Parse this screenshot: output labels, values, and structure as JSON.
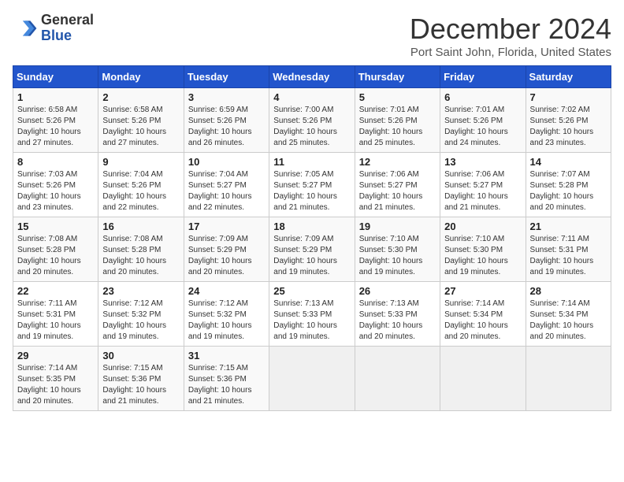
{
  "header": {
    "logo_line1": "General",
    "logo_line2": "Blue",
    "title": "December 2024",
    "subtitle": "Port Saint John, Florida, United States"
  },
  "days_of_week": [
    "Sunday",
    "Monday",
    "Tuesday",
    "Wednesday",
    "Thursday",
    "Friday",
    "Saturday"
  ],
  "weeks": [
    [
      {
        "day": "1",
        "info": "Sunrise: 6:58 AM\nSunset: 5:26 PM\nDaylight: 10 hours\nand 27 minutes."
      },
      {
        "day": "2",
        "info": "Sunrise: 6:58 AM\nSunset: 5:26 PM\nDaylight: 10 hours\nand 27 minutes."
      },
      {
        "day": "3",
        "info": "Sunrise: 6:59 AM\nSunset: 5:26 PM\nDaylight: 10 hours\nand 26 minutes."
      },
      {
        "day": "4",
        "info": "Sunrise: 7:00 AM\nSunset: 5:26 PM\nDaylight: 10 hours\nand 25 minutes."
      },
      {
        "day": "5",
        "info": "Sunrise: 7:01 AM\nSunset: 5:26 PM\nDaylight: 10 hours\nand 25 minutes."
      },
      {
        "day": "6",
        "info": "Sunrise: 7:01 AM\nSunset: 5:26 PM\nDaylight: 10 hours\nand 24 minutes."
      },
      {
        "day": "7",
        "info": "Sunrise: 7:02 AM\nSunset: 5:26 PM\nDaylight: 10 hours\nand 23 minutes."
      }
    ],
    [
      {
        "day": "8",
        "info": "Sunrise: 7:03 AM\nSunset: 5:26 PM\nDaylight: 10 hours\nand 23 minutes."
      },
      {
        "day": "9",
        "info": "Sunrise: 7:04 AM\nSunset: 5:26 PM\nDaylight: 10 hours\nand 22 minutes."
      },
      {
        "day": "10",
        "info": "Sunrise: 7:04 AM\nSunset: 5:27 PM\nDaylight: 10 hours\nand 22 minutes."
      },
      {
        "day": "11",
        "info": "Sunrise: 7:05 AM\nSunset: 5:27 PM\nDaylight: 10 hours\nand 21 minutes."
      },
      {
        "day": "12",
        "info": "Sunrise: 7:06 AM\nSunset: 5:27 PM\nDaylight: 10 hours\nand 21 minutes."
      },
      {
        "day": "13",
        "info": "Sunrise: 7:06 AM\nSunset: 5:27 PM\nDaylight: 10 hours\nand 21 minutes."
      },
      {
        "day": "14",
        "info": "Sunrise: 7:07 AM\nSunset: 5:28 PM\nDaylight: 10 hours\nand 20 minutes."
      }
    ],
    [
      {
        "day": "15",
        "info": "Sunrise: 7:08 AM\nSunset: 5:28 PM\nDaylight: 10 hours\nand 20 minutes."
      },
      {
        "day": "16",
        "info": "Sunrise: 7:08 AM\nSunset: 5:28 PM\nDaylight: 10 hours\nand 20 minutes."
      },
      {
        "day": "17",
        "info": "Sunrise: 7:09 AM\nSunset: 5:29 PM\nDaylight: 10 hours\nand 20 minutes."
      },
      {
        "day": "18",
        "info": "Sunrise: 7:09 AM\nSunset: 5:29 PM\nDaylight: 10 hours\nand 19 minutes."
      },
      {
        "day": "19",
        "info": "Sunrise: 7:10 AM\nSunset: 5:30 PM\nDaylight: 10 hours\nand 19 minutes."
      },
      {
        "day": "20",
        "info": "Sunrise: 7:10 AM\nSunset: 5:30 PM\nDaylight: 10 hours\nand 19 minutes."
      },
      {
        "day": "21",
        "info": "Sunrise: 7:11 AM\nSunset: 5:31 PM\nDaylight: 10 hours\nand 19 minutes."
      }
    ],
    [
      {
        "day": "22",
        "info": "Sunrise: 7:11 AM\nSunset: 5:31 PM\nDaylight: 10 hours\nand 19 minutes."
      },
      {
        "day": "23",
        "info": "Sunrise: 7:12 AM\nSunset: 5:32 PM\nDaylight: 10 hours\nand 19 minutes."
      },
      {
        "day": "24",
        "info": "Sunrise: 7:12 AM\nSunset: 5:32 PM\nDaylight: 10 hours\nand 19 minutes."
      },
      {
        "day": "25",
        "info": "Sunrise: 7:13 AM\nSunset: 5:33 PM\nDaylight: 10 hours\nand 19 minutes."
      },
      {
        "day": "26",
        "info": "Sunrise: 7:13 AM\nSunset: 5:33 PM\nDaylight: 10 hours\nand 20 minutes."
      },
      {
        "day": "27",
        "info": "Sunrise: 7:14 AM\nSunset: 5:34 PM\nDaylight: 10 hours\nand 20 minutes."
      },
      {
        "day": "28",
        "info": "Sunrise: 7:14 AM\nSunset: 5:34 PM\nDaylight: 10 hours\nand 20 minutes."
      }
    ],
    [
      {
        "day": "29",
        "info": "Sunrise: 7:14 AM\nSunset: 5:35 PM\nDaylight: 10 hours\nand 20 minutes."
      },
      {
        "day": "30",
        "info": "Sunrise: 7:15 AM\nSunset: 5:36 PM\nDaylight: 10 hours\nand 21 minutes."
      },
      {
        "day": "31",
        "info": "Sunrise: 7:15 AM\nSunset: 5:36 PM\nDaylight: 10 hours\nand 21 minutes."
      },
      null,
      null,
      null,
      null
    ]
  ]
}
